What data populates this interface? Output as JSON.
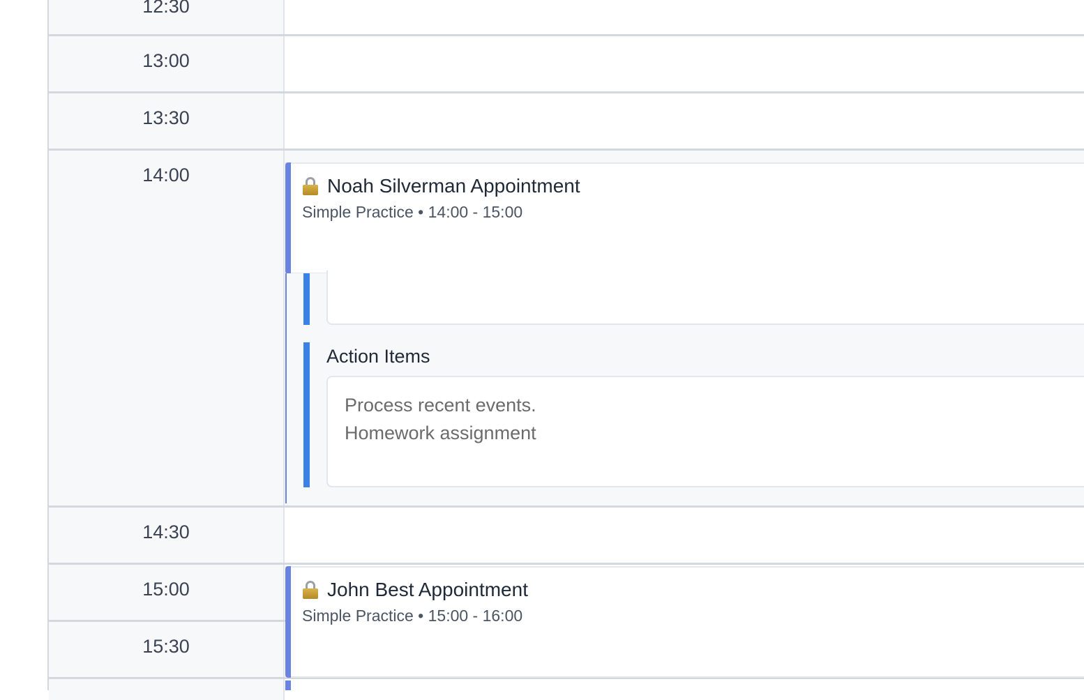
{
  "times": [
    "12:30",
    "13:00",
    "13:30",
    "14:00",
    "14:30",
    "15:00",
    "15:30"
  ],
  "appointments": [
    {
      "title": "Noah Silverman Appointment",
      "subtitle": "Simple Practice • 14:00 - 15:00",
      "icon": "lock-icon"
    },
    {
      "title": "John Best Appointment",
      "subtitle": "Simple Practice • 15:00 - 16:00",
      "icon": "lock-icon"
    }
  ],
  "notes": {
    "action_items_title": "Action Items",
    "action_items_text": "Process recent events.\nHomework assignment"
  },
  "colors": {
    "appointment_accent": "#6a82e0",
    "section_accent": "#3b82e6"
  }
}
